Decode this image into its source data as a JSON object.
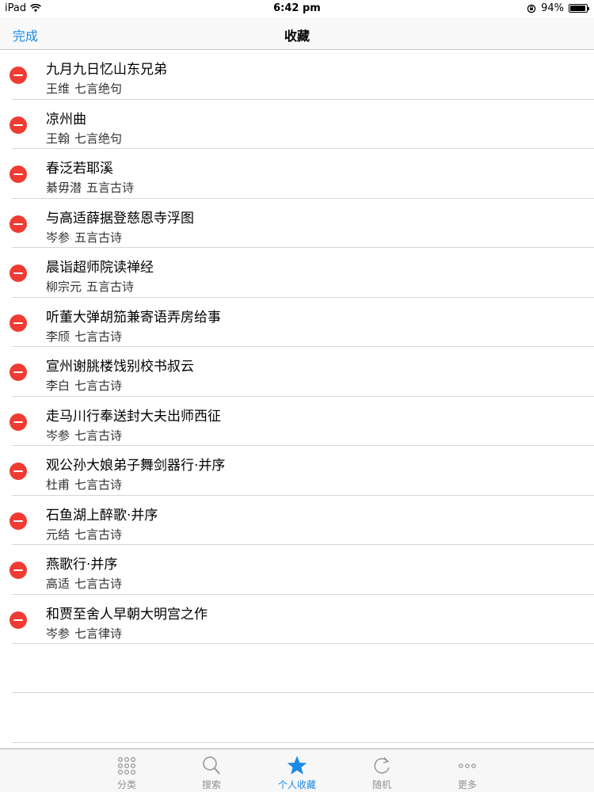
{
  "status": {
    "device": "iPad",
    "time": "6:42 pm",
    "battery": "94%"
  },
  "nav": {
    "done_label": "完成",
    "title": "收藏"
  },
  "favorites": [
    {
      "title": "九月九日忆山东兄弟",
      "author": "王维",
      "form": "七言绝句"
    },
    {
      "title": "凉州曲",
      "author": "王翰",
      "form": "七言绝句"
    },
    {
      "title": "春泛若耶溪",
      "author": "綦毋潜",
      "form": "五言古诗"
    },
    {
      "title": "与高适薛据登慈恩寺浮图",
      "author": "岑参",
      "form": "五言古诗"
    },
    {
      "title": "晨诣超师院读禅经",
      "author": "柳宗元",
      "form": "五言古诗"
    },
    {
      "title": "听董大弹胡笳兼寄语弄房给事",
      "author": "李颀",
      "form": "七言古诗"
    },
    {
      "title": "宣州谢朓楼饯别校书叔云",
      "author": "李白",
      "form": "七言古诗"
    },
    {
      "title": "走马川行奉送封大夫出师西征",
      "author": "岑参",
      "form": "七言古诗"
    },
    {
      "title": "观公孙大娘弟子舞剑器行·并序",
      "author": "杜甫",
      "form": "七言古诗"
    },
    {
      "title": "石鱼湖上醉歌·并序",
      "author": "元结",
      "form": "七言古诗"
    },
    {
      "title": "燕歌行·并序",
      "author": "高适",
      "form": "七言古诗"
    },
    {
      "title": "和贾至舍人早朝大明宫之作",
      "author": "岑参",
      "form": "七言律诗"
    }
  ],
  "tabs": [
    {
      "label": "分类",
      "icon": "grid-dots-icon",
      "active": false
    },
    {
      "label": "搜索",
      "icon": "search-icon",
      "active": false
    },
    {
      "label": "个人收藏",
      "icon": "star-icon",
      "active": true
    },
    {
      "label": "随机",
      "icon": "refresh-icon",
      "active": false
    },
    {
      "label": "更多",
      "icon": "more-icon",
      "active": false
    }
  ],
  "colors": {
    "accent": "#1a8ae6",
    "delete": "#f03b32",
    "tab_inactive": "#929292"
  }
}
